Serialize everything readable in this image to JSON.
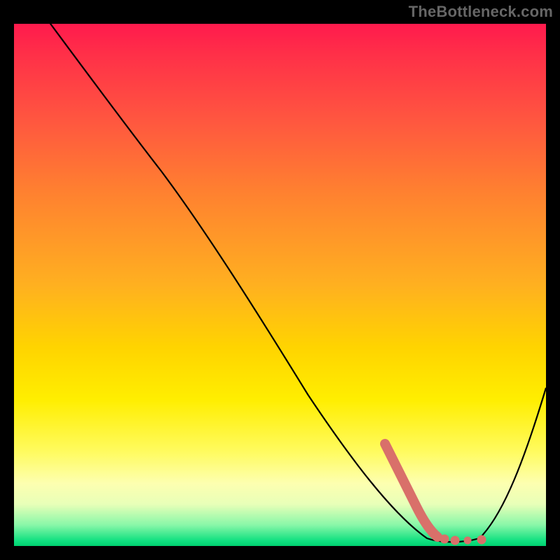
{
  "attribution": "TheBottleneck.com",
  "chart_data": {
    "type": "line",
    "title": "",
    "xlabel": "",
    "ylabel": "",
    "xlim": [
      0,
      100
    ],
    "ylim": [
      0,
      100
    ],
    "series": [
      {
        "name": "bottleneck-curve",
        "x": [
          0,
          12,
          28,
          40,
          52,
          64,
          72,
          78,
          82,
          86,
          92,
          100
        ],
        "values": [
          110,
          100,
          80,
          62,
          44,
          26,
          12,
          4,
          1,
          1,
          8,
          32
        ]
      }
    ],
    "annotations": [
      {
        "name": "optimal-marker",
        "points": [
          {
            "x": 71,
            "y": 15
          },
          {
            "x": 72,
            "y": 13
          },
          {
            "x": 73,
            "y": 11
          },
          {
            "x": 74,
            "y": 9
          },
          {
            "x": 75,
            "y": 7
          },
          {
            "x": 76,
            "y": 5.5
          },
          {
            "x": 77,
            "y": 4
          },
          {
            "x": 78,
            "y": 3
          },
          {
            "x": 79,
            "y": 2.2
          },
          {
            "x": 80,
            "y": 1.8
          },
          {
            "x": 82,
            "y": 1.5
          },
          {
            "x": 84,
            "y": 1.5
          },
          {
            "x": 86,
            "y": 1.5
          }
        ],
        "color": "#d9706a"
      }
    ],
    "gradient_stops": [
      {
        "pos": 0.0,
        "color": "#ff1a4d"
      },
      {
        "pos": 0.5,
        "color": "#ffd400"
      },
      {
        "pos": 0.88,
        "color": "#fdffb0"
      },
      {
        "pos": 1.0,
        "color": "#00d070"
      }
    ]
  }
}
